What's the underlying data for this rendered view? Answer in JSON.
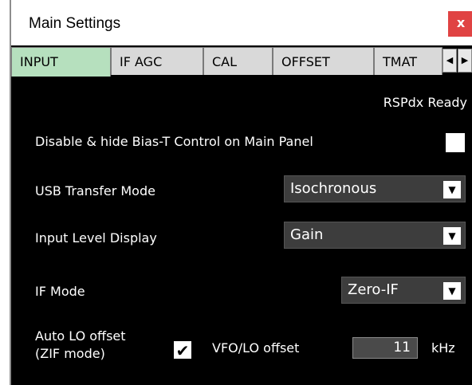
{
  "window": {
    "title": "Main Settings",
    "close_glyph": "x"
  },
  "tabs": [
    {
      "label": "INPUT",
      "active": true
    },
    {
      "label": "IF AGC",
      "active": false
    },
    {
      "label": "CAL",
      "active": false
    },
    {
      "label": "OFFSET",
      "active": false
    },
    {
      "label": "TMAT",
      "active": false
    }
  ],
  "tab_scroll": {
    "left_glyph": "◀",
    "right_glyph": "▶"
  },
  "status": "RSPdx Ready",
  "bias_t": {
    "label": "Disable & hide Bias-T Control on Main Panel",
    "checked": false
  },
  "usb_transfer": {
    "label": "USB Transfer Mode",
    "value": "Isochronous"
  },
  "input_level": {
    "label": "Input Level Display",
    "value": "Gain"
  },
  "if_mode": {
    "label": "IF Mode",
    "value": "Zero-IF"
  },
  "auto_lo": {
    "label_line1": "Auto LO offset",
    "label_line2": "(ZIF mode)",
    "checked": true,
    "check_glyph": "✔"
  },
  "vfo_lo": {
    "label": "VFO/LO offset",
    "value": "11",
    "unit": "kHz"
  },
  "colors": {
    "panel_bg": "#000000",
    "active_tab": "#b6e0be",
    "inactive_tab": "#d9d9d9",
    "close_button": "#e04343",
    "dropdown_bg": "#3d3d3d"
  },
  "icons": {
    "dropdown_arrow": "▼"
  }
}
